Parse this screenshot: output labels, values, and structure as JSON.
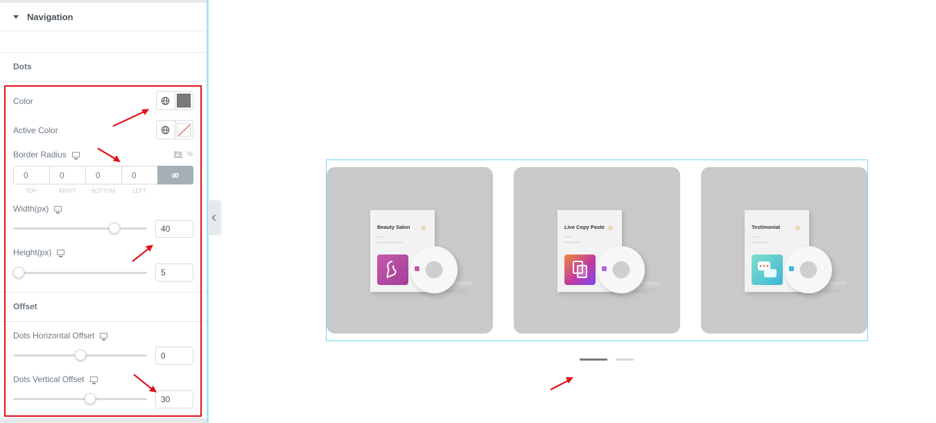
{
  "panel": {
    "section_title": "Navigation",
    "dots_heading": "Dots",
    "color_label": "Color",
    "active_color_label": "Active Color",
    "border_radius_label": "Border Radius",
    "unit_px": "PX",
    "unit_pct": "%",
    "dimensions": {
      "top": "0",
      "right": "0",
      "bottom": "0",
      "left": "0",
      "labels": [
        "TOP",
        "RIGHT",
        "BOTTOM",
        "LEFT"
      ]
    },
    "width_label": "Width(px)",
    "width_value": "40",
    "height_label": "Height(px)",
    "height_value": "5",
    "offset_heading": "Offset",
    "h_offset_label": "Dots Horizontal Offset",
    "h_offset_value": "0",
    "v_offset_label": "Dots Vertical Offset",
    "v_offset_value": "30"
  },
  "colors": {
    "dot_color": "#7a7a7a",
    "active_dot_color": "none",
    "annotation": "#e3111a"
  },
  "slider_levels": {
    "width": 0.78,
    "height": 0.0,
    "h_offset": 0.5,
    "v_offset": 0.58
  },
  "preview": {
    "cards": [
      {
        "title": "Beauty Salon"
      },
      {
        "title": "Live Copy Paste"
      },
      {
        "title": "Testimonial"
      }
    ],
    "dots": {
      "count": 2,
      "active_index": 0
    }
  }
}
